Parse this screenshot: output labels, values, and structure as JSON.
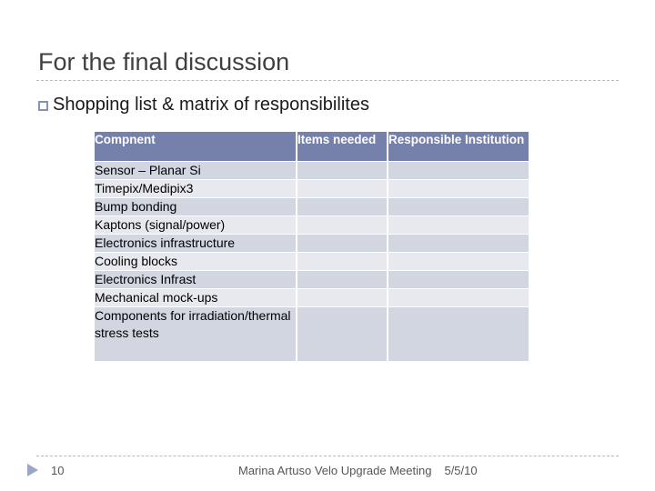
{
  "slide": {
    "title": "For the final discussion",
    "bullet": {
      "icon": "hollow-square-bullet",
      "text": "Shopping list & matrix of responsibilites"
    }
  },
  "table": {
    "headers": [
      "Compnent",
      "Items needed",
      "Responsible Institution"
    ],
    "rows": [
      {
        "component": "Sensor – Planar Si",
        "items_needed": "",
        "responsible_institution": ""
      },
      {
        "component": "Timepix/Medipix3",
        "items_needed": "",
        "responsible_institution": ""
      },
      {
        "component": "Bump bonding",
        "items_needed": "",
        "responsible_institution": ""
      },
      {
        "component": "Kaptons  (signal/power)",
        "items_needed": "",
        "responsible_institution": ""
      },
      {
        "component": "Electronics infrastructure",
        "items_needed": "",
        "responsible_institution": ""
      },
      {
        "component": "Cooling blocks",
        "items_needed": "",
        "responsible_institution": ""
      },
      {
        "component": "Electronics Infrast",
        "items_needed": "",
        "responsible_institution": ""
      },
      {
        "component": "Mechanical mock-ups",
        "items_needed": "",
        "responsible_institution": ""
      },
      {
        "component": "Components for irradiation/thermal stress tests",
        "items_needed": "",
        "responsible_institution": ""
      }
    ]
  },
  "footer": {
    "nav_icon": "play-triangle-icon",
    "slide_number": "10",
    "center_text": "Marina Artuso Velo Upgrade Meeting",
    "date": "5/5/10"
  },
  "colors": {
    "header_background": "#7581AB",
    "row_dark": "#D2D6E0",
    "row_light": "#E8E9EE",
    "title_text": "#3F3F3F",
    "bullet_accent": "#8591B5",
    "footer_text": "#555555",
    "footer_triangle": "#9AA6C6",
    "rule": "#B9B9B9"
  }
}
